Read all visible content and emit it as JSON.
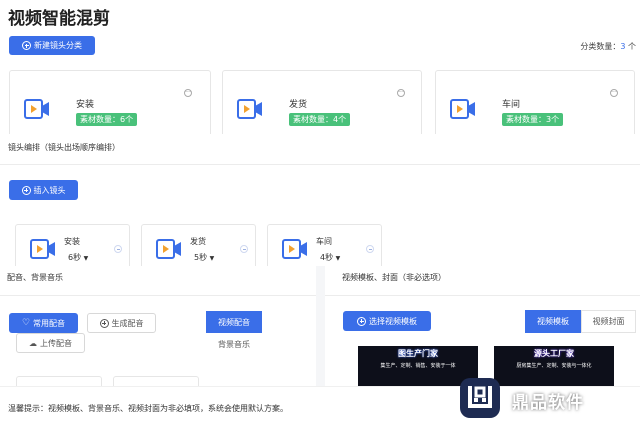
{
  "page": {
    "title": "视频智能混剪"
  },
  "categories": {
    "new_button_label": "新建镜头分类",
    "count_label": "分类数量：",
    "count_value": "3",
    "count_unit": "个",
    "items": [
      {
        "name": "安装",
        "badge": "素材数量：6个"
      },
      {
        "name": "发货",
        "badge": "素材数量：4个"
      },
      {
        "name": "车间",
        "badge": "素材数量：3个"
      }
    ]
  },
  "arrangement": {
    "label": "镜头编排（镜头出场顺序编排）",
    "insert_button_label": "插入镜头",
    "shots": [
      {
        "name": "安装",
        "duration": "6秒",
        "caret": "▼"
      },
      {
        "name": "发货",
        "duration": "5秒",
        "caret": "▼"
      },
      {
        "name": "车间",
        "duration": "4秒",
        "caret": "▼"
      }
    ]
  },
  "audio": {
    "label": "配音、背景音乐",
    "common_voice_label": "常用配音",
    "generate_voice_label": "生成配音",
    "upload_voice_label": "上传配音",
    "tab_voice": "视频配音",
    "tab_bgm": "背景音乐"
  },
  "template": {
    "label": "视频模板、封面（非必选项）",
    "select_button_label": "选择视频模板",
    "tab_template": "视频模板",
    "tab_cover": "视频封面",
    "thumb1": {
      "title": "图生产门家",
      "sub": "集生产、定制、销售、安装于一体"
    },
    "thumb2": {
      "title": "源头工厂家",
      "sub": "厨房集生产、定制、安装与一体化"
    }
  },
  "tip": "温馨提示：视频模板、背景音乐、视频封面为非必填项，系统会使用默认方案。",
  "watermark": {
    "text": "鼎品软件"
  },
  "colors": {
    "primary": "#3a6ee8",
    "badge": "#49c17a",
    "camera_body": "#3a6ee8",
    "play": "#f2a12e"
  }
}
